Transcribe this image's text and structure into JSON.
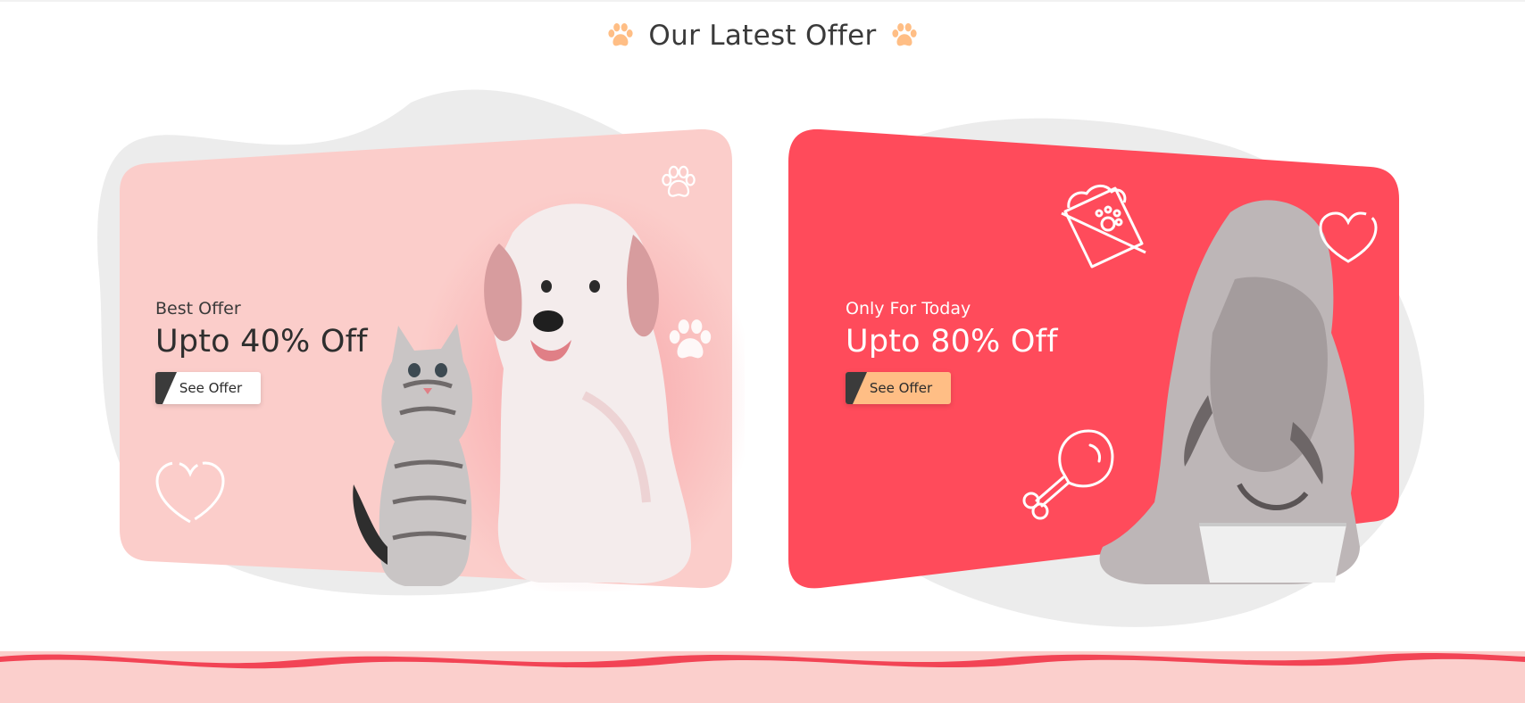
{
  "section": {
    "title": "Our Latest Offer",
    "icons": [
      "paw-icon",
      "paw-icon"
    ]
  },
  "colors": {
    "accent_orange": "#ffbe85",
    "card_left_bg": "#fbcdca",
    "card_right_bg": "#ff4b5b",
    "blob_gray": "#ececec",
    "bottom_band": "#fbcfcc",
    "wave_red": "#f24455"
  },
  "offers": [
    {
      "subtitle": "Best Offer",
      "headline": "Upto 40% Off",
      "button_label": "See Offer",
      "image": "puppy-and-kitten-photo",
      "decorations": [
        "paw-icon",
        "paw-icon",
        "heart-icon"
      ]
    },
    {
      "subtitle": "Only For Today",
      "headline": "Upto 80% Off",
      "button_label": "See Offer",
      "image": "dog-eating-from-bowl-photo",
      "decorations": [
        "pet-food-bowl-icon",
        "heart-icon",
        "chicken-leg-icon"
      ]
    }
  ]
}
